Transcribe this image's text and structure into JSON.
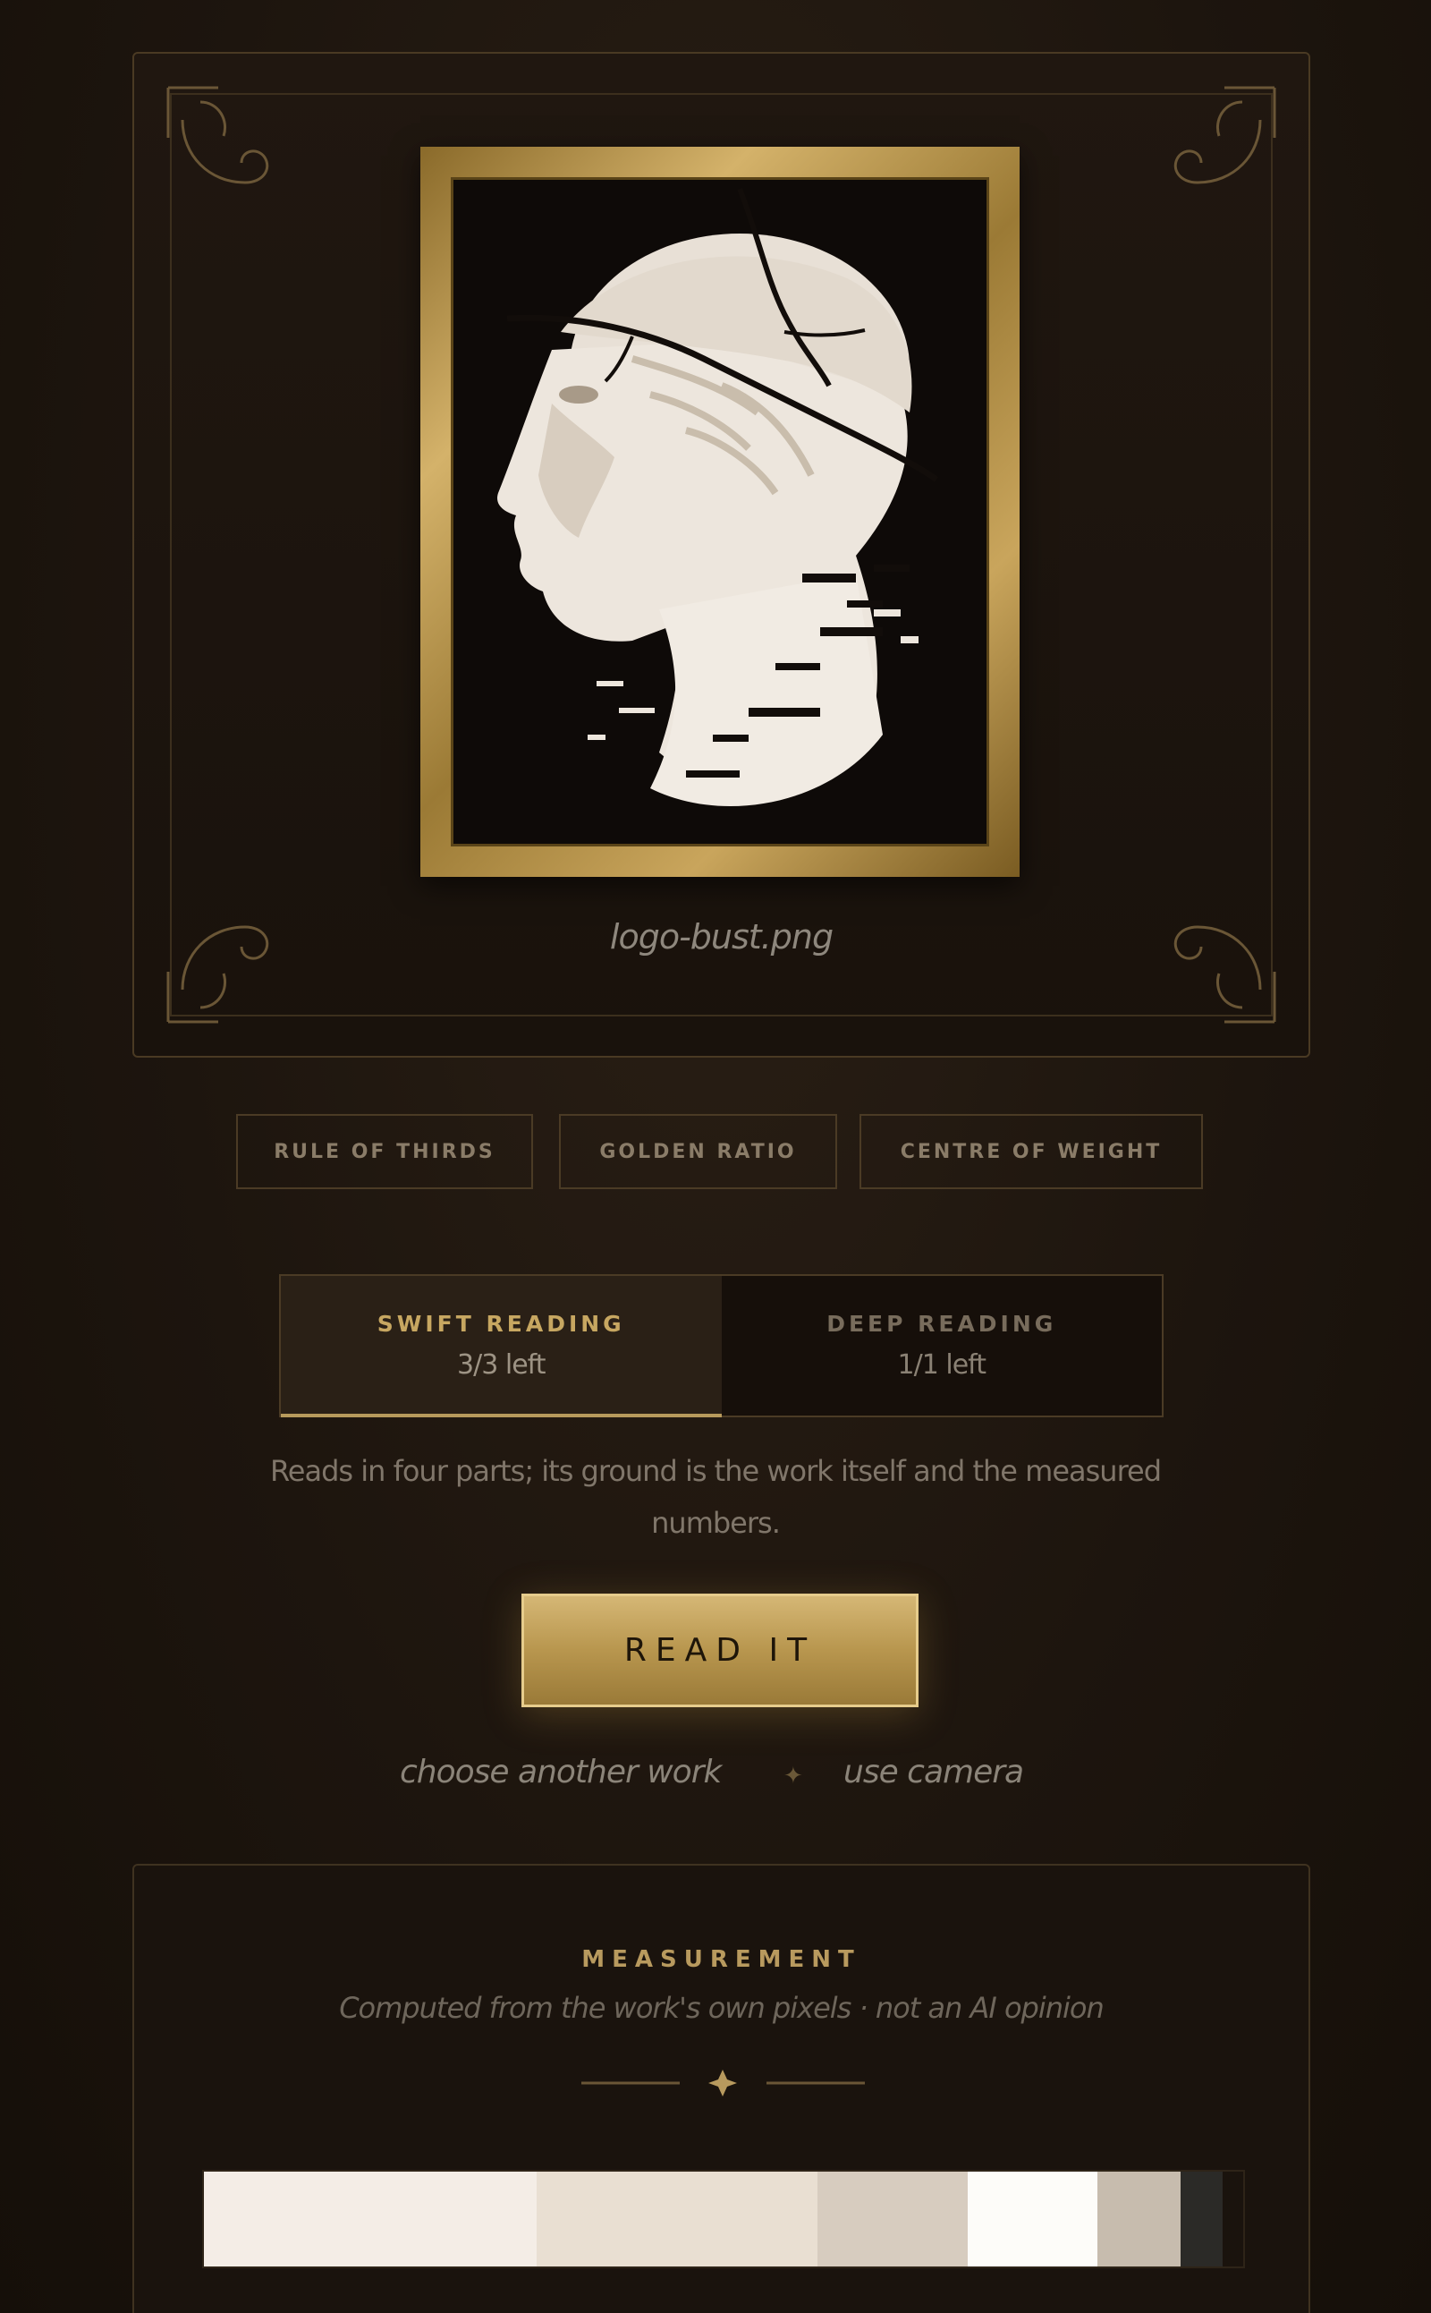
{
  "artwork": {
    "filename": "logo-bust.png"
  },
  "tools": [
    {
      "label": "RULE OF THIRDS"
    },
    {
      "label": "GOLDEN RATIO"
    },
    {
      "label": "CENTRE OF WEIGHT"
    }
  ],
  "modes": [
    {
      "title": "SWIFT READING",
      "remaining": "3/3 left",
      "active": true
    },
    {
      "title": "DEEP READING",
      "remaining": "1/1 left",
      "active": false
    }
  ],
  "description": "Reads in four parts; its ground is the work itself and the measured numbers.",
  "read_button": "READ IT",
  "links": {
    "choose": "choose another work",
    "separator": "✦",
    "camera": "use camera"
  },
  "measurement": {
    "title": "MEASUREMENT",
    "subtitle": "Computed from the work's own pixels · not an AI opinion",
    "palette": [
      {
        "color": "#f4ede6",
        "share": 0.32
      },
      {
        "color": "#e9dfd2",
        "share": 0.27
      },
      {
        "color": "#d7ccbf",
        "share": 0.145
      },
      {
        "color": "#fdfcf9",
        "share": 0.125
      },
      {
        "color": "#c7bcae",
        "share": 0.08
      },
      {
        "color": "#2b2a27",
        "share": 0.04
      }
    ]
  },
  "colors": {
    "gold": "#c7a761",
    "background": "#1c140d",
    "frame_border": "#4a3a23"
  }
}
